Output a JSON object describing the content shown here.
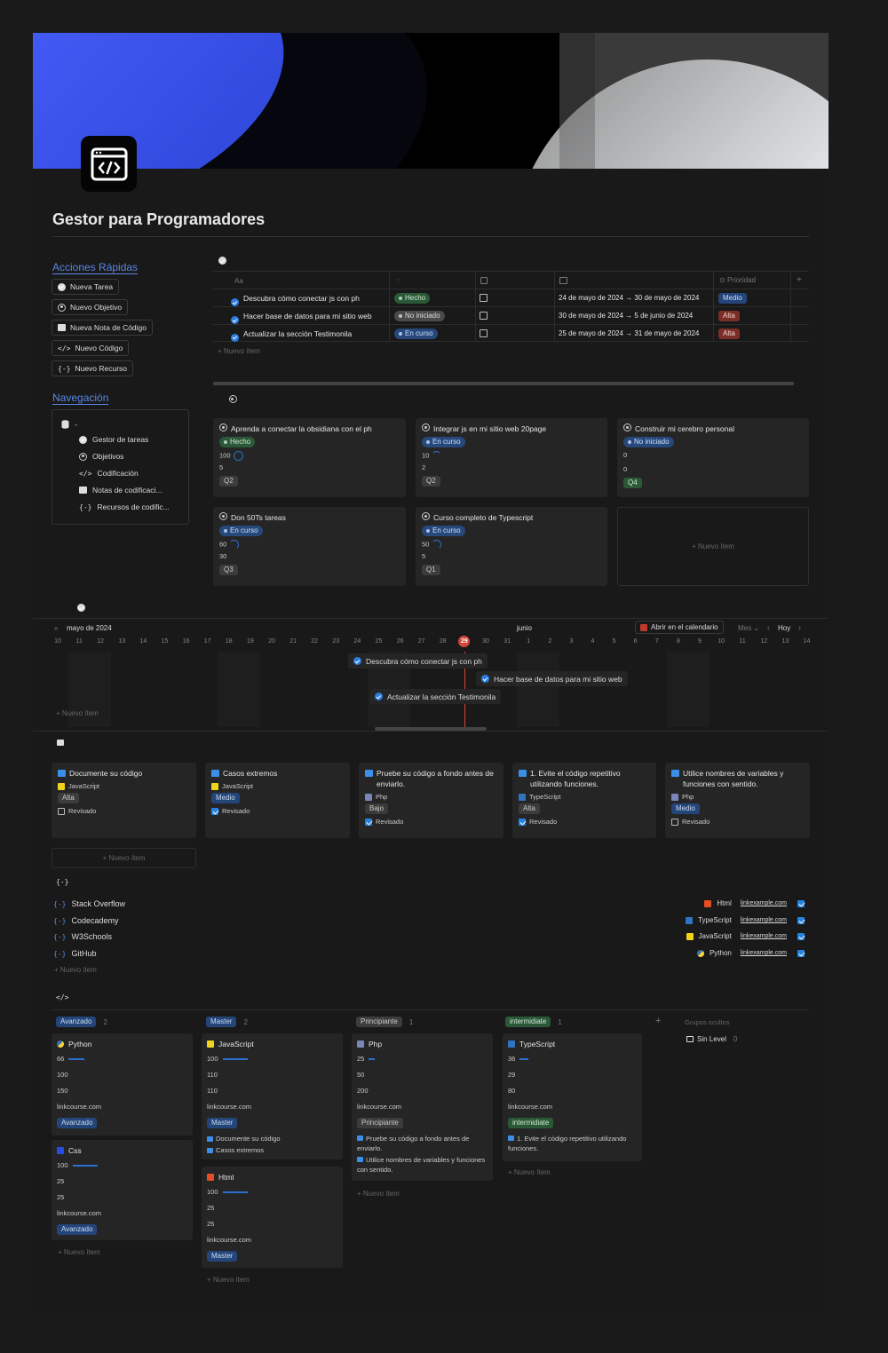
{
  "page": {
    "title": "Gestor para Programadores"
  },
  "sidebar": {
    "quick_title": "Acciones Rápidas",
    "quick": [
      {
        "label": "Nueva Tarea",
        "icon": "check-circle-icon"
      },
      {
        "label": "Nuevo Objetivo",
        "icon": "target-icon"
      },
      {
        "label": "Nueva Nota de Código",
        "icon": "image-icon"
      },
      {
        "label": "Nuevo Código",
        "icon": "code-icon"
      },
      {
        "label": "Nuevo Recurso",
        "icon": "braces-icon"
      }
    ],
    "nav_title": "Navegación",
    "nav_root": "-",
    "nav": [
      {
        "label": "Gestor de tareas",
        "icon": "check-circle-icon"
      },
      {
        "label": "Objetivos",
        "icon": "target-icon"
      },
      {
        "label": "Codificación",
        "icon": "code-icon"
      },
      {
        "label": "Notas de codificaci...",
        "icon": "image-icon"
      },
      {
        "label": "Recursos de codific...",
        "icon": "braces-icon"
      }
    ]
  },
  "tasks": {
    "headers": {
      "name": "Aa",
      "priority": "Prioridad",
      "add": "+"
    },
    "rows": [
      {
        "name": "Descubra cómo conectar js con ph",
        "status": "Hecho",
        "checked": false,
        "date": "24 de mayo de 2024 → 30 de mayo de 2024",
        "priority": "Medio"
      },
      {
        "name": "Hacer base de datos para mi sitio web",
        "status": "No iniciado",
        "checked": false,
        "date": "30 de mayo de 2024 → 5 de junio de 2024",
        "priority": "Alta"
      },
      {
        "name": "Actualizar la sección Testimonila",
        "status": "En curso",
        "checked": false,
        "date": "25 de mayo de 2024 → 31 de mayo de 2024",
        "priority": "Alta"
      }
    ],
    "new_item": "+ Nuevo ítem"
  },
  "goals": {
    "cards": [
      {
        "title": "Aprenda a conectar la obsidiana con el ph",
        "status": "Hecho",
        "v1": "100",
        "v2": "5",
        "q": "Q2",
        "progress": 1.0
      },
      {
        "title": "Integrar js en mi sitio web 20page",
        "status": "En curso",
        "v1": "10",
        "v2": "2",
        "q": "Q2",
        "progress": 0.1
      },
      {
        "title": "Construir mi cerebro personal",
        "status": "No iniciado",
        "v1": "0",
        "v2": "0",
        "q": "Q4",
        "progress": 0
      },
      {
        "title": "Don 50Ts tareas",
        "status": "En curso",
        "v1": "60",
        "v2": "30",
        "q": "Q3",
        "progress": 0.6
      },
      {
        "title": "Curso completo de Typescript",
        "status": "En curso",
        "v1": "50",
        "v2": "5",
        "q": "Q1",
        "progress": 0.5
      }
    ],
    "new_item": "+ Nuevo ítem"
  },
  "timeline": {
    "month1": "mayo de 2024",
    "month2": "junio",
    "open_calendar": "Abrir en el calendario",
    "view": "Mes",
    "today": "Hoy",
    "days": [
      "10",
      "11",
      "12",
      "13",
      "14",
      "15",
      "16",
      "17",
      "18",
      "19",
      "20",
      "21",
      "22",
      "23",
      "24",
      "25",
      "26",
      "27",
      "28",
      "29",
      "30",
      "31",
      "1",
      "2",
      "3",
      "4",
      "5",
      "6",
      "7",
      "8",
      "9",
      "10",
      "11",
      "12",
      "13",
      "14"
    ],
    "today_day": "29",
    "items": [
      "Descubra cómo conectar js con ph",
      "Hacer base de datos para mi sitio web",
      "Actualizar la sección Testimonila"
    ],
    "new_item": "+ Nuevo ítem"
  },
  "notes": {
    "cards": [
      {
        "title": "Documente su código",
        "lang": "JavaScript",
        "priority": "Alta",
        "reviewed": false,
        "review_label": "Revisado"
      },
      {
        "title": "Casos extremos",
        "lang": "JavaScript",
        "priority": "Medio",
        "reviewed": true,
        "review_label": "Revisado"
      },
      {
        "title": "Pruebe su código a fondo antes de enviarlo.",
        "lang": "Php",
        "priority": "Bajo",
        "reviewed": true,
        "review_label": "Revisado"
      },
      {
        "title": "1. Evite el código repetitivo utilizando funciones.",
        "lang": "TypeScript",
        "priority": "Alta",
        "reviewed": true,
        "review_label": "Revisado"
      },
      {
        "title": "Utilice nombres de variables y funciones con sentido.",
        "lang": "Php",
        "priority": "Medio",
        "reviewed": false,
        "review_label": "Revisado"
      }
    ],
    "new_item": "+ Nuevo ítem"
  },
  "resources": {
    "links": [
      "Stack Overflow",
      "Codecademy",
      "W3Schools",
      "GitHub"
    ],
    "right": [
      {
        "lang": "Html",
        "url": "linkexample.com"
      },
      {
        "lang": "TypeScript",
        "url": "linkexample.com"
      },
      {
        "lang": "JavaScript",
        "url": "linkexample.com"
      },
      {
        "lang": "Python",
        "url": "linkexample.com"
      }
    ],
    "new_item": "+ Nuevo ítem"
  },
  "code_board": {
    "columns": [
      {
        "name": "Avanzado",
        "count": "2"
      },
      {
        "name": "Master",
        "count": "2"
      },
      {
        "name": "Principiante",
        "count": "1"
      },
      {
        "name": "intermidiate",
        "count": "1"
      }
    ],
    "add": "+",
    "hidden_groups": "Grupos ocultos",
    "sin_level": "Sin Level",
    "sin_level_count": "0",
    "cards": {
      "python": {
        "name": "Python",
        "v": [
          "66",
          "100",
          "150"
        ],
        "link": "linkcourse.com",
        "tag": "Avanzado",
        "progress": 0.66
      },
      "css": {
        "name": "Css",
        "v": [
          "100",
          "25",
          "25"
        ],
        "link": "linkcourse.com",
        "tag": "Avanzado",
        "progress": 1.0
      },
      "javascript": {
        "name": "JavaScript",
        "v": [
          "100",
          "110",
          "110"
        ],
        "link": "linkcourse.com",
        "tag": "Master",
        "notes": [
          "Documente su código",
          "Casos extremos"
        ],
        "progress": 1.0
      },
      "html": {
        "name": "Html",
        "v": [
          "100",
          "25",
          "25"
        ],
        "link": "linkcourse.com",
        "tag": "Master",
        "progress": 1.0
      },
      "php": {
        "name": "Php",
        "v": [
          "25",
          "50",
          "200"
        ],
        "link": "linkcourse.com",
        "tag": "Principiante",
        "notes": [
          "Pruebe su código a fondo antes de enviarlo.",
          "Utilice nombres de variables y funciones con sentido."
        ],
        "progress": 0.25
      },
      "typescript": {
        "name": "TypeScript",
        "v": [
          "36",
          "29",
          "80"
        ],
        "link": "linkcourse.com",
        "tag": "intermidiate",
        "notes": [
          "1. Evite el código repetitivo utilizando funciones."
        ],
        "progress": 0.36
      }
    },
    "new_item": "+ Nuevo ítem"
  }
}
